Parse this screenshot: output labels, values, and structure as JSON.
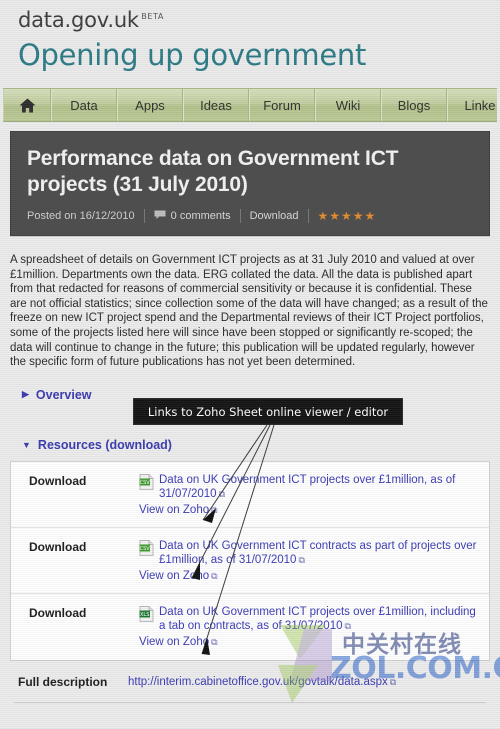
{
  "site": {
    "brand": "data.gov.uk",
    "beta_badge": "BETA",
    "tagline": "Opening up government"
  },
  "nav": {
    "items": [
      {
        "label": "",
        "icon": "home-icon",
        "name": "nav-home"
      },
      {
        "label": "Data",
        "name": "nav-data"
      },
      {
        "label": "Apps",
        "name": "nav-apps"
      },
      {
        "label": "Ideas",
        "name": "nav-ideas"
      },
      {
        "label": "Forum",
        "name": "nav-forum"
      },
      {
        "label": "Wiki",
        "name": "nav-wiki"
      },
      {
        "label": "Blogs",
        "name": "nav-blogs"
      },
      {
        "label": "Linke",
        "name": "nav-linked-data"
      }
    ]
  },
  "article": {
    "title": "Performance data on Government ICT projects (31 July 2010)",
    "posted": "Posted on 16/12/2010",
    "comments": "0 comments",
    "download_label": "Download",
    "stars": "★★★★★",
    "rating": 5,
    "description": "A spreadsheet of details on Government ICT projects as at 31 July 2010 and valued at over £1million. Departments own the data. ERG collated the data. All the data is published apart from that redacted for reasons of commercial sensitivity or because it is confidential. These are not official statistics; since collection some of the data will have changed; as a result of the freeze on new ICT project spend and the Departmental reviews of their ICT Project portfolios, some of the projects listed here will since have been stopped or significantly re-scoped; the data will continue to change in the future; this publication will be updated regularly, however the specific form of future publications has not yet been determined."
  },
  "sections": {
    "overview": {
      "label": "Overview",
      "triangle": "▶",
      "expanded": false
    },
    "resources": {
      "label": "Resources (download)",
      "triangle": "▼",
      "expanded": true
    }
  },
  "resources": {
    "rows": [
      {
        "label": "Download",
        "filetype": "CSV",
        "title": "Data on UK Government ICT projects over £1million, as of 31/07/2010",
        "ext_marker": "⧉",
        "viewer_link": "View on Zoho"
      },
      {
        "label": "Download",
        "filetype": "CSV",
        "title": "Data on UK Government ICT contracts as part of projects over £1million, as of 31/07/2010",
        "ext_marker": "⧉",
        "viewer_link": "View on Zoho"
      },
      {
        "label": "Download",
        "filetype": "XLS",
        "title": "Data on UK Government ICT projects over £1million, including a tab on contracts, as of 31/07/2010",
        "ext_marker": "⧉",
        "viewer_link": "View on Zoho"
      }
    ]
  },
  "full_description": {
    "label": "Full description",
    "url": "http://interim.cabinetoffice.gov.uk/govtalk/data.aspx",
    "ext_marker": "⧉"
  },
  "annotation": {
    "callout_text": "Links to Zoho Sheet online viewer / editor"
  },
  "watermark": {
    "chinese": "中关村在线",
    "latin": "ZOL.COM.CN"
  },
  "colors": {
    "tagline": "#2b7a86",
    "nav_green": "#bccb97",
    "title_bar": "#4a4a4a",
    "link_blue": "#3b3bb5",
    "star_orange": "#e08a2e",
    "callout_bg": "#141414"
  }
}
